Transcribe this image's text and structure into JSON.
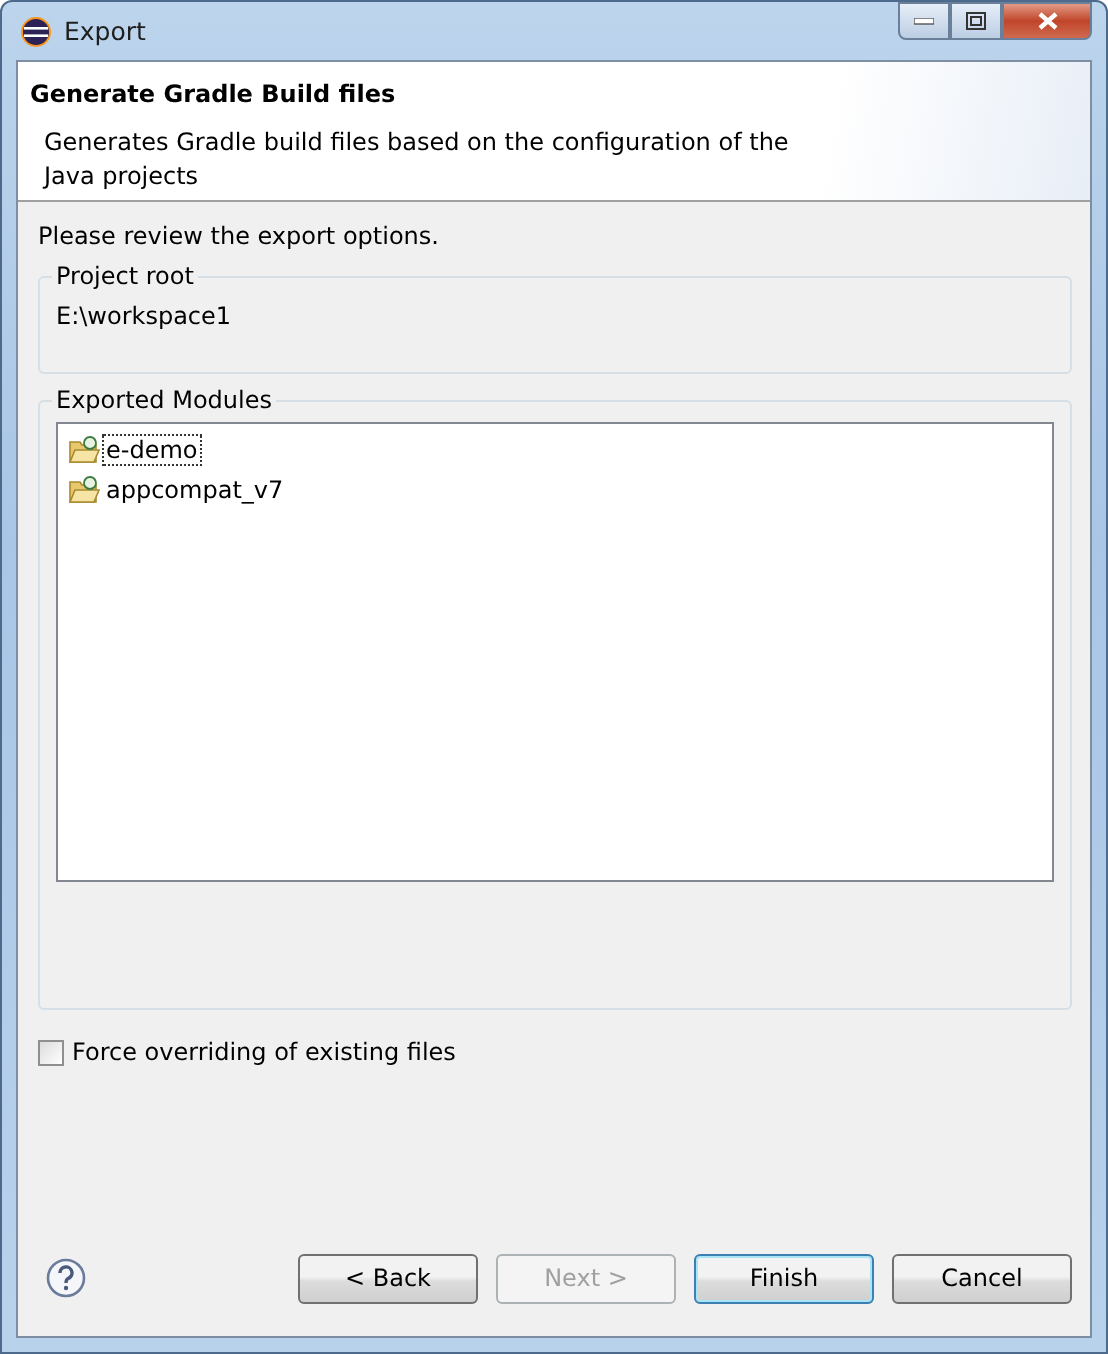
{
  "window": {
    "title": "Export"
  },
  "header": {
    "title": "Generate Gradle Build files",
    "description": "Generates Gradle build files based on the configuration of the Java projects"
  },
  "instruction": "Please review the export options.",
  "project_root": {
    "label": "Project root",
    "value": "E:\\workspace1"
  },
  "modules": {
    "label": "Exported Modules",
    "items": [
      {
        "name": "e-demo",
        "selected": true
      },
      {
        "name": "appcompat_v7",
        "selected": false
      }
    ]
  },
  "force_override": {
    "label": "Force overriding of existing files",
    "checked": false
  },
  "buttons": [
    {
      "label": "< Back",
      "disabled": false,
      "default": false
    },
    {
      "label": "Next >",
      "disabled": true,
      "default": false
    },
    {
      "label": "Finish",
      "disabled": false,
      "default": true
    },
    {
      "label": "Cancel",
      "disabled": false,
      "default": false
    }
  ]
}
